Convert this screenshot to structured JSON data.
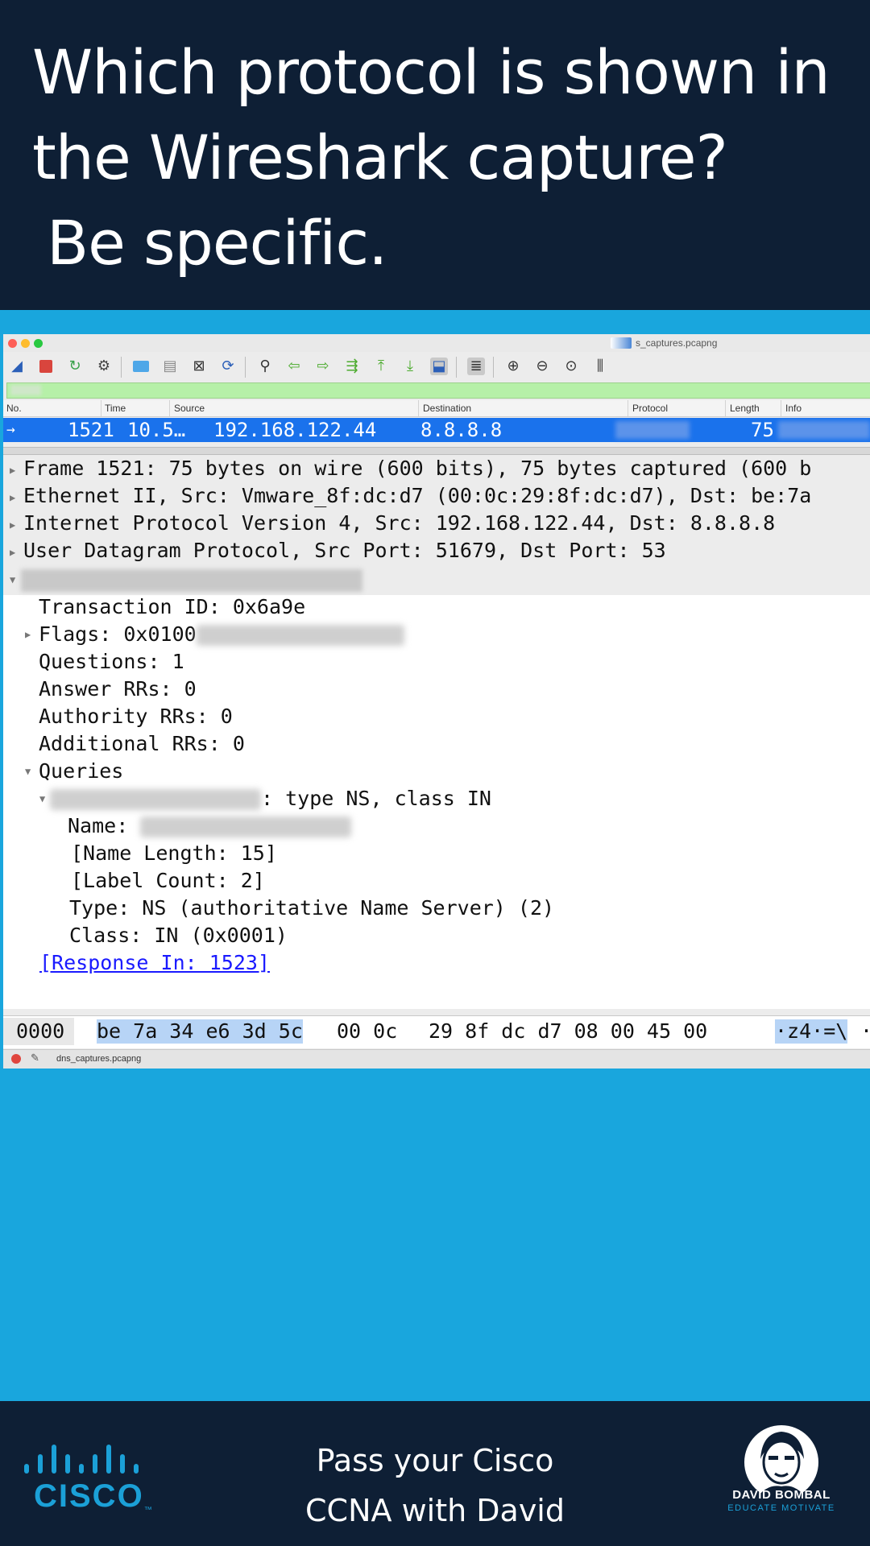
{
  "header": {
    "line1": "Which protocol is shown in",
    "line2": "the Wireshark capture?",
    "line3": "Be specific."
  },
  "window": {
    "title": "s_captures.pcapng",
    "toolbar_icons": [
      "shark-fin-icon",
      "stop-icon",
      "restart-icon",
      "gear-icon",
      "folder-icon",
      "file-icon",
      "close-file-icon",
      "reload-icon",
      "search-icon",
      "arrow-left-icon",
      "arrow-right-icon",
      "jump-icon",
      "go-first-icon",
      "go-last-icon",
      "autoscroll-icon",
      "colorize-icon",
      "zoom-in-icon",
      "zoom-out-icon",
      "zoom-reset-icon",
      "resize-columns-icon"
    ]
  },
  "columns": {
    "no": "No.",
    "time": "Time",
    "source": "Source",
    "destination": "Destination",
    "protocol": "Protocol",
    "length": "Length",
    "info": "Info"
  },
  "packet": {
    "no": "1521",
    "time": "10.5…",
    "source": "192.168.122.44",
    "destination": "8.8.8.8",
    "length": "75"
  },
  "details": {
    "frame": "Frame 1521: 75 bytes on wire (600 bits), 75 bytes captured (600 b",
    "ethernet": "Ethernet II, Src: Vmware_8f:dc:d7 (00:0c:29:8f:dc:d7), Dst: be:7a",
    "ip": "Internet Protocol Version 4, Src: 192.168.122.44, Dst: 8.8.8.8",
    "udp": "User Datagram Protocol, Src Port: 51679, Dst Port: 53",
    "transaction_id": "Transaction ID: 0x6a9e",
    "flags": "Flags: 0x0100",
    "questions": "Questions: 1",
    "answer_rrs": "Answer RRs: 0",
    "authority_rrs": "Authority RRs: 0",
    "additional_rrs": "Additional RRs: 0",
    "queries": "Queries",
    "query_suffix": ": type NS, class IN",
    "name": "Name:",
    "name_length": "[Name Length: 15]",
    "label_count": "[Label Count: 2]",
    "type": "Type: NS (authoritative Name Server) (2)",
    "class": "Class: IN (0x0001)",
    "response_in": "[Response In: 1523]"
  },
  "hex": {
    "offset": "0000",
    "bytes_hl": "be 7a 34 e6 3d 5c",
    "bytes_rest1": "00 0c",
    "bytes_rest2": "29 8f dc d7 08 00 45 00",
    "ascii": "·z4·=\\",
    "ascii_tail": "·"
  },
  "status": {
    "file": "dns_captures.pcapng"
  },
  "footer": {
    "line1": "Pass your Cisco",
    "line2": "CCNA with David",
    "cisco": "CISCO",
    "cisco_tm": "™",
    "brand_name": "DAVID BOMBAL",
    "brand_tag": "EDUCATE MOTIVATE"
  },
  "colors": {
    "header_bg": "#0e1f35",
    "accent_blue": "#19a6dd",
    "selection": "#1a72ec",
    "filter_ok": "#b6f0a8",
    "cisco_blue": "#1ba0d7"
  }
}
